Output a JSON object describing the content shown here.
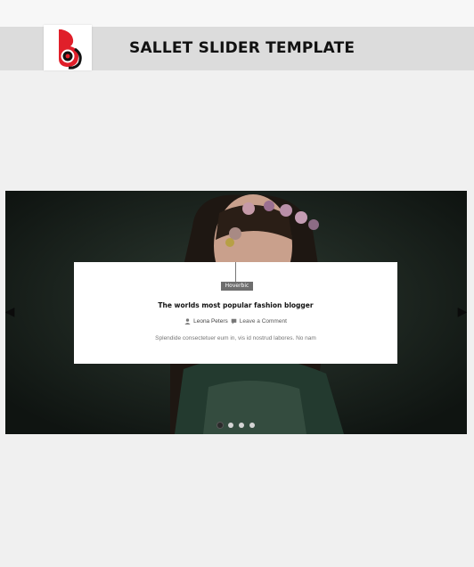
{
  "header": {
    "title": "SALLET SLIDER TEMPLATE",
    "logo_icon": "brand-logo-icon",
    "accent_color": "#e01f2a"
  },
  "slider": {
    "prev_icon": "chevron-left-icon",
    "next_icon": "chevron-right-icon",
    "slides_total": 4,
    "active_slide": 1,
    "slide": {
      "category": "Hoverbic",
      "title": "The worlds most popular fashion blogger",
      "author": "Leona Peters",
      "author_icon": "user-icon",
      "comment_icon": "comment-icon",
      "comment_link": "Leave a Comment",
      "excerpt": "Splendide consectetuer eum in, vis id nostrud labores. No nam"
    }
  }
}
